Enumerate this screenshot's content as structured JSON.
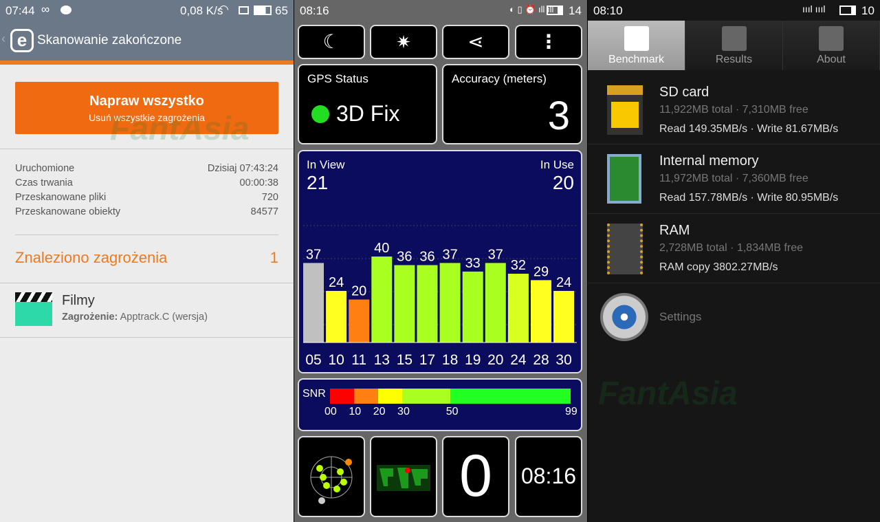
{
  "watermark": "FantAsia",
  "left": {
    "status": {
      "time": "07:44",
      "speed": "0,08 K/s",
      "battery": "65"
    },
    "header": {
      "title": "Skanowanie zakończone"
    },
    "fix_button": {
      "label": "Napraw wszystko",
      "sub": "Usuń wszystkie zagrożenia"
    },
    "info": [
      {
        "label": "Uruchomione",
        "value": "Dzisiaj 07:43:24"
      },
      {
        "label": "Czas trwania",
        "value": "00:00:38"
      },
      {
        "label": "Przeskanowane pliki",
        "value": "720"
      },
      {
        "label": "Przeskanowane obiekty",
        "value": "84577"
      }
    ],
    "threats": {
      "label": "Znaleziono zagrożenia",
      "count": "1"
    },
    "threat_item": {
      "name": "Filmy",
      "label": "Zagrożenie:",
      "value": "Apptrack.C (wersja)"
    },
    "colors": {
      "accent": "#f06a12",
      "header": "#6b7888"
    }
  },
  "mid": {
    "status": {
      "time": "08:16",
      "battery": "14"
    },
    "gps": {
      "label": "GPS Status",
      "value": "3D Fix"
    },
    "accuracy": {
      "label": "Accuracy (meters)",
      "value": "3"
    },
    "inview": {
      "label": "In View",
      "value": "21"
    },
    "inuse": {
      "label": "In Use",
      "value": "20"
    },
    "chart_data": {
      "type": "bar",
      "categories": [
        "05",
        "10",
        "11",
        "13",
        "15",
        "17",
        "18",
        "19",
        "20",
        "24",
        "28",
        "30"
      ],
      "values": [
        37,
        24,
        20,
        40,
        36,
        36,
        37,
        33,
        37,
        32,
        29,
        24
      ],
      "colors": [
        "#c0c0c0",
        "#ffff20",
        "#ff8010",
        "#a8ff20",
        "#a8ff20",
        "#a8ff20",
        "#a8ff20",
        "#a8ff20",
        "#a8ff20",
        "#d8ff20",
        "#ffff20",
        "#ffff20"
      ]
    },
    "snr": {
      "label": "SNR",
      "ticks": [
        "00",
        "10",
        "20",
        "30",
        "50",
        "99"
      ]
    },
    "speed": "0",
    "clock": "08:16"
  },
  "right": {
    "status": {
      "time": "08:10",
      "battery": "10"
    },
    "tabs": [
      "Benchmark",
      "Results",
      "About"
    ],
    "items": [
      {
        "title": "SD card",
        "sub": "11,922MB total · 7,310MB free",
        "speed": "Read 149.35MB/s · Write 81.67MB/s"
      },
      {
        "title": "Internal memory",
        "sub": "11,972MB total · 7,360MB free",
        "speed": "Read 157.78MB/s · Write 80.95MB/s"
      },
      {
        "title": "RAM",
        "sub": "2,728MB total · 1,834MB free",
        "speed": "RAM copy 3802.27MB/s"
      }
    ],
    "settings": "Settings"
  }
}
